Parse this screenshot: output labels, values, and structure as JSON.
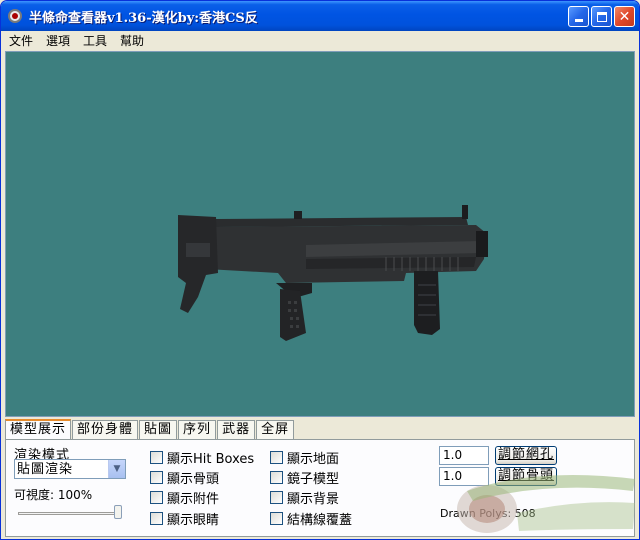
{
  "window": {
    "title": "半條命查看器v1.36-漢化by:香港CS反",
    "controls": {
      "minimize_icon": "minimize-icon",
      "maximize_icon": "maximize-icon",
      "close_icon": "close-icon"
    }
  },
  "menu": [
    "文件",
    "選項",
    "工具",
    "幫助"
  ],
  "tabs": [
    "模型展示",
    "部份身體",
    "貼圖",
    "序列",
    "武器",
    "全屏"
  ],
  "panel": {
    "render_mode_label": "渲染模式",
    "render_mode_value": "貼圖渲染",
    "opacity_label": "可視度: 100%",
    "opacity_value": 1.0,
    "checkboxes_col1": [
      "顯示Hit Boxes",
      "顯示骨頭",
      "顯示附件",
      "顯示眼睛"
    ],
    "checkboxes_col2": [
      "顯示地面",
      "鏡子模型",
      "顯示背景",
      "結構線覆蓋"
    ],
    "input1_value": "1.0",
    "input2_value": "1.0",
    "button1_label": "調節網孔",
    "button2_label": "調節骨頭",
    "polys_label": "Drawn Polys: 508"
  },
  "colors": {
    "viewport_bg": "#3d7f7f",
    "titlebar": "#0054e3",
    "active_tab_accent": "#e68b2c"
  }
}
